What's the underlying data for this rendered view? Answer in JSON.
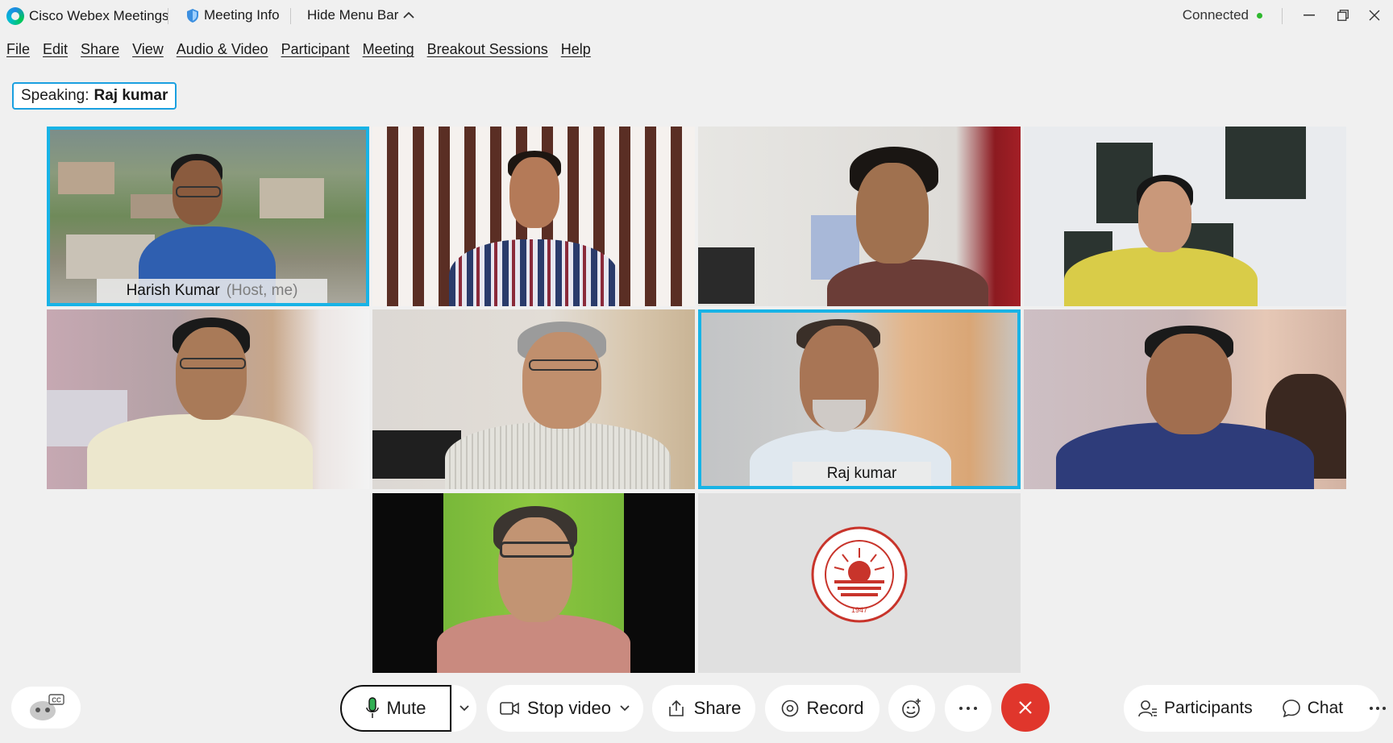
{
  "titlebar": {
    "app_title": "Cisco Webex Meetings",
    "meeting_info": "Meeting Info",
    "hide_menu_bar": "Hide Menu Bar",
    "status": "Connected",
    "status_color": "#2eb82e"
  },
  "menubar": {
    "items": [
      "File",
      "Edit",
      "Share",
      "View",
      "Audio & Video",
      "Participant",
      "Meeting",
      "Breakout Sessions",
      "Help"
    ]
  },
  "speaking": {
    "label": "Speaking:",
    "name": "Raj kumar"
  },
  "tiles": {
    "t1": {
      "name": "Harish Kumar",
      "role": "(Host, me)"
    },
    "t7": {
      "name": "Raj kumar"
    },
    "logo_year": "1947"
  },
  "controls": {
    "mute": "Mute",
    "stop_video": "Stop video",
    "share": "Share",
    "record": "Record",
    "participants": "Participants",
    "chat": "Chat"
  },
  "colors": {
    "accent": "#18b3e6",
    "end_call": "#e0362c"
  }
}
